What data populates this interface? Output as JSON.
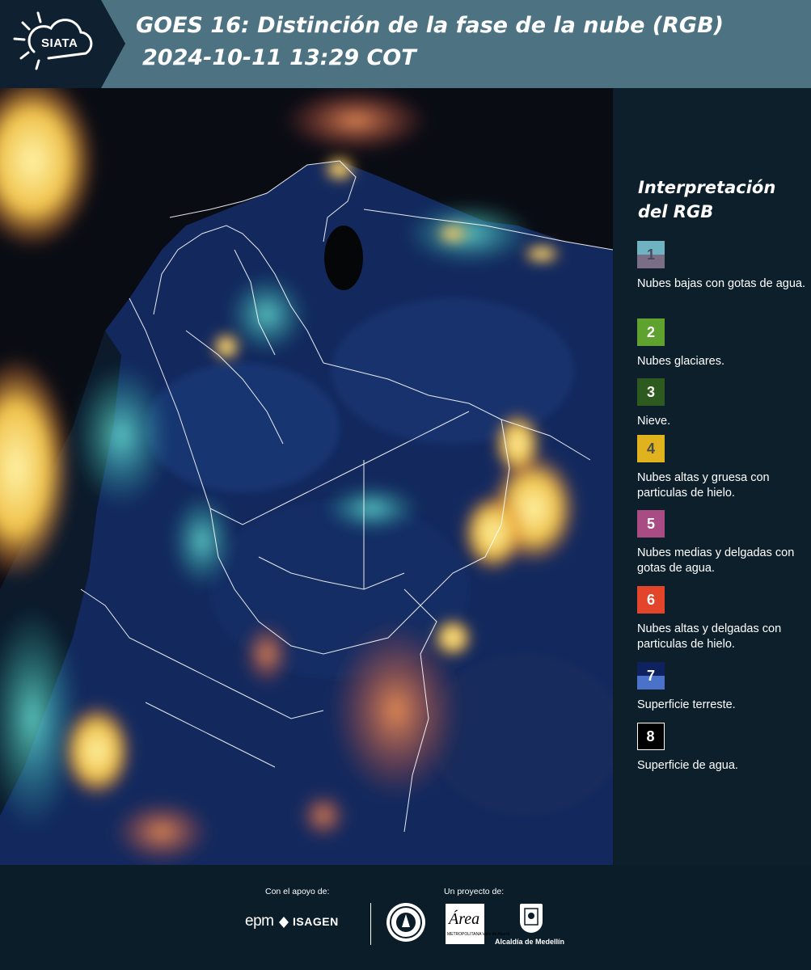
{
  "header": {
    "logo_text": "SIATA",
    "title_line1": "GOES 16: Distinción de la fase de la nube (RGB)",
    "title_line2": "2024-10-11 13:29 COT"
  },
  "legend": {
    "title_line1": "Interpretación",
    "title_line2": "del RGB",
    "items": [
      {
        "number": "1",
        "label": "Nubes bajas con gotas de agua.",
        "color_top": "#6fb3c3",
        "color_bottom": "#7a6e86",
        "num_color": "#4a4a5a"
      },
      {
        "number": "2",
        "label": "Nubes glaciares.",
        "color_top": "#5fa230",
        "color_bottom": "#5fa230",
        "num_color": "#ffffff"
      },
      {
        "number": "3",
        "label": "Nieve.",
        "color_top": "#2d5a1e",
        "color_bottom": "#2d5a1e",
        "num_color": "#ffffff"
      },
      {
        "number": "4",
        "label": "Nubes altas y gruesa con particulas de hielo.",
        "color_top": "#e0b21e",
        "color_bottom": "#e0b21e",
        "num_color": "#4a4a4a"
      },
      {
        "number": "5",
        "label": "Nubes medias y delgadas con gotas de agua.",
        "color_top": "#a94c83",
        "color_bottom": "#a94c83",
        "num_color": "#ffffff"
      },
      {
        "number": "6",
        "label": "Nubes altas y delgadas con particulas de hielo.",
        "color_top": "#e2452a",
        "color_bottom": "#e2452a",
        "num_color": "#ffffff"
      },
      {
        "number": "7",
        "label": "Superficie terreste.",
        "color_top": "#0f2260",
        "color_bottom": "#4a72c9",
        "num_color": "#ffffff"
      },
      {
        "number": "8",
        "label": "Superficie de agua.",
        "color_top": "#000000",
        "color_bottom": "#000000",
        "num_color": "#ffffff"
      }
    ]
  },
  "footer": {
    "support_label": "Con el apoyo de:",
    "project_label": "Un proyecto de:",
    "sponsor_1": "epm",
    "sponsor_2": "ISAGEN",
    "partner_area": "Área",
    "partner_area_sub": "METROPOLITANA Valle de Aburrá",
    "partner_alcaldia": "Alcaldía de Medellín"
  },
  "colors": {
    "header_bg": "#4d7382",
    "logo_bg": "#0f2130",
    "panel_bg": "#0d1f2b",
    "land": "#16306a",
    "ocean": "#0a0c14",
    "cloud_low": "#5fd6c2",
    "cloud_high": "#f0c24a"
  }
}
